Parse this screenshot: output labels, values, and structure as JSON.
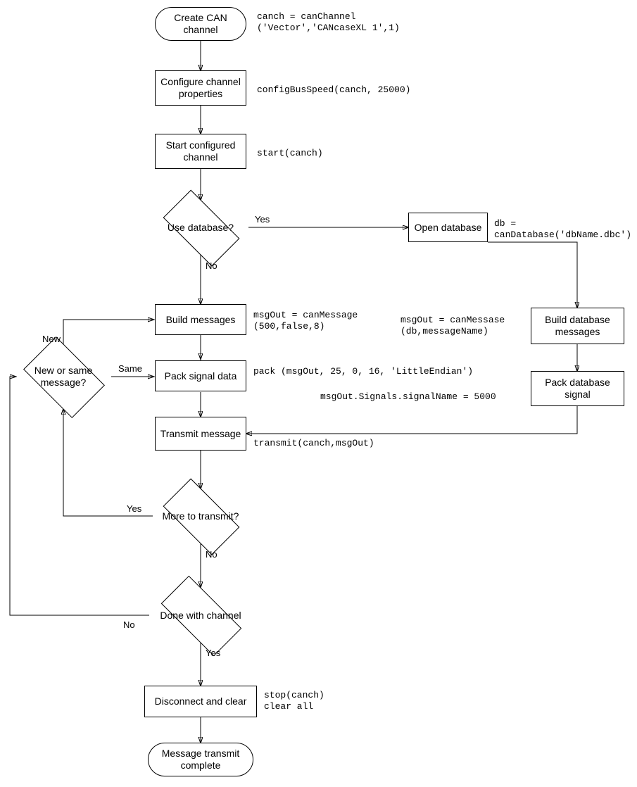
{
  "nodes": {
    "create": "Create CAN channel",
    "configure": "Configure channel properties",
    "start": "Start configured channel",
    "useDb": "Use database?",
    "openDb": "Open database",
    "buildMsg": "Build messages",
    "buildDbMsg": "Build database messages",
    "packSig": "Pack signal data",
    "packDbSig": "Pack database signal",
    "newOrSame": "New or same message?",
    "transmit": "Transmit message",
    "more": "More to transmit?",
    "done": "Done with channel",
    "disconnect": "Disconnect and clear",
    "complete": "Message transmit complete"
  },
  "edgeLabels": {
    "useDbYes": "Yes",
    "useDbNo": "No",
    "newOrSameNew": "New",
    "newOrSameSame": "Same",
    "moreYes": "Yes",
    "moreNo": "No",
    "doneYes": "Yes",
    "doneNo": "No"
  },
  "code": {
    "create": "canch = canChannel\n('Vector','CANcaseXL 1',1)",
    "configure": "configBusSpeed(canch, 25000)",
    "start": "start(canch)",
    "openDb": "db =\ncanDatabase('dbName.dbc')",
    "buildMsg": "msgOut = canMessage\n(500,false,8)",
    "buildDbMsg": "msgOut = canMessase\n(db,messageName)",
    "packSig": "pack (msgOut, 25, 0, 16, 'LittleEndian')",
    "packDbSig": "msgOut.Signals.signalName = 5000",
    "transmit": "transmit(canch,msgOut)",
    "disconnect": "stop(canch)\nclear all"
  },
  "chart_data": {
    "type": "flowchart",
    "nodes": [
      {
        "id": "create",
        "kind": "terminator",
        "label": "Create CAN channel",
        "code": "canch = canChannel('Vector','CANcaseXL 1',1)"
      },
      {
        "id": "configure",
        "kind": "process",
        "label": "Configure channel properties",
        "code": "configBusSpeed(canch, 25000)"
      },
      {
        "id": "start",
        "kind": "process",
        "label": "Start configured channel",
        "code": "start(canch)"
      },
      {
        "id": "useDb",
        "kind": "decision",
        "label": "Use database?"
      },
      {
        "id": "openDb",
        "kind": "process",
        "label": "Open database",
        "code": "db = canDatabase('dbName.dbc')"
      },
      {
        "id": "buildMsg",
        "kind": "process",
        "label": "Build messages",
        "code": "msgOut = canMessage(500,false,8)"
      },
      {
        "id": "buildDbMsg",
        "kind": "process",
        "label": "Build database messages",
        "code": "msgOut = canMessase(db,messageName)"
      },
      {
        "id": "newOrSame",
        "kind": "decision",
        "label": "New or same message?"
      },
      {
        "id": "packSig",
        "kind": "process",
        "label": "Pack signal data",
        "code": "pack (msgOut, 25, 0, 16, 'LittleEndian')"
      },
      {
        "id": "packDbSig",
        "kind": "process",
        "label": "Pack database signal",
        "code": "msgOut.Signals.signalName = 5000"
      },
      {
        "id": "transmit",
        "kind": "process",
        "label": "Transmit message",
        "code": "transmit(canch,msgOut)"
      },
      {
        "id": "more",
        "kind": "decision",
        "label": "More to transmit?"
      },
      {
        "id": "done",
        "kind": "decision",
        "label": "Done with channel"
      },
      {
        "id": "disconnect",
        "kind": "process",
        "label": "Disconnect and clear",
        "code": "stop(canch); clear all"
      },
      {
        "id": "complete",
        "kind": "terminator",
        "label": "Message transmit complete"
      }
    ],
    "edges": [
      {
        "from": "create",
        "to": "configure"
      },
      {
        "from": "configure",
        "to": "start"
      },
      {
        "from": "start",
        "to": "useDb"
      },
      {
        "from": "useDb",
        "to": "openDb",
        "label": "Yes"
      },
      {
        "from": "useDb",
        "to": "buildMsg",
        "label": "No"
      },
      {
        "from": "openDb",
        "to": "buildDbMsg"
      },
      {
        "from": "buildDbMsg",
        "to": "packDbSig"
      },
      {
        "from": "packDbSig",
        "to": "transmit"
      },
      {
        "from": "buildMsg",
        "to": "packSig"
      },
      {
        "from": "packSig",
        "to": "transmit"
      },
      {
        "from": "transmit",
        "to": "more"
      },
      {
        "from": "more",
        "to": "newOrSame",
        "label": "Yes"
      },
      {
        "from": "more",
        "to": "done",
        "label": "No"
      },
      {
        "from": "newOrSame",
        "to": "buildMsg",
        "label": "New"
      },
      {
        "from": "newOrSame",
        "to": "packSig",
        "label": "Same"
      },
      {
        "from": "done",
        "to": "newOrSame",
        "label": "No"
      },
      {
        "from": "done",
        "to": "disconnect",
        "label": "Yes"
      },
      {
        "from": "disconnect",
        "to": "complete"
      }
    ]
  }
}
